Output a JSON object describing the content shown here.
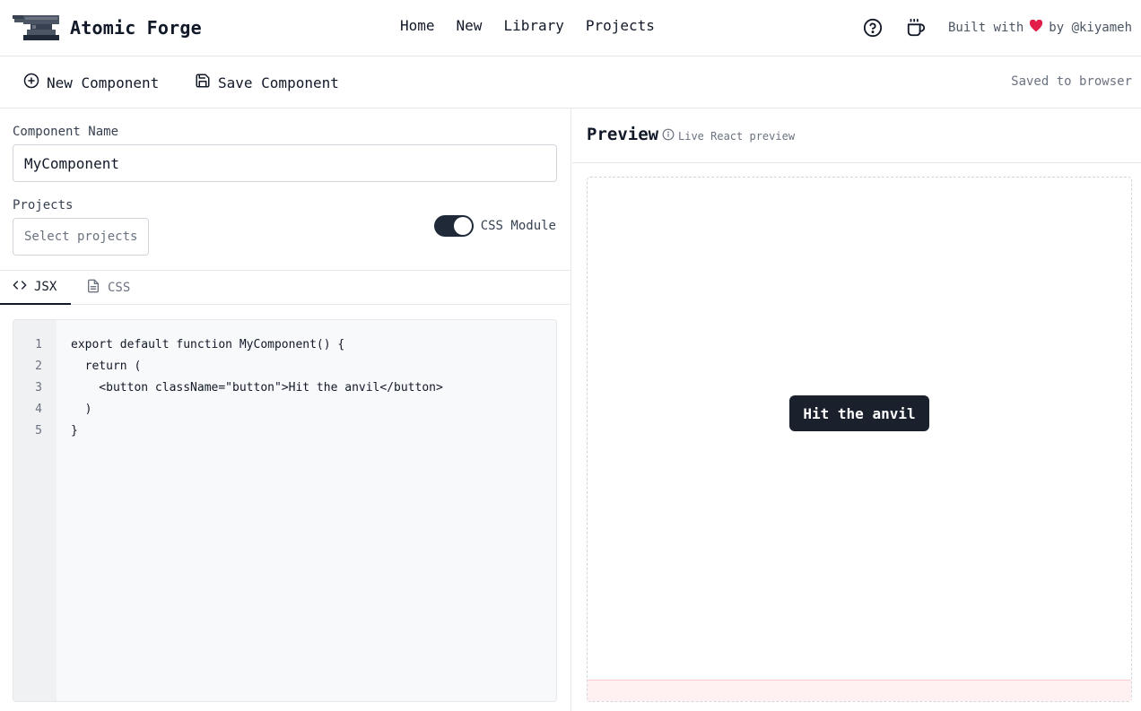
{
  "header": {
    "brand_title": "Atomic Forge",
    "nav": [
      "Home",
      "New",
      "Library",
      "Projects"
    ],
    "built_with": "Built with",
    "by_author": "by @kiyameh",
    "heart_color": "#e11d48"
  },
  "toolbar": {
    "new_component": "New Component",
    "save_component": "Save Component",
    "saved_status": "Saved to browser"
  },
  "form": {
    "component_name_label": "Component Name",
    "component_name_value": "MyComponent",
    "projects_label": "Projects",
    "projects_placeholder": "Select projects",
    "css_module_label": "CSS Module",
    "css_module_enabled": true
  },
  "tabs": {
    "jsx": "JSX",
    "css": "CSS",
    "active": "JSX"
  },
  "editor": {
    "line_numbers": [
      "1",
      "2",
      "3",
      "4",
      "5"
    ],
    "lines": [
      "export default function MyComponent() {",
      "  return (",
      "    <button className=\"button\">Hit the anvil</button>",
      "  )",
      "}"
    ]
  },
  "preview": {
    "title": "Preview",
    "subtitle": "Live React preview",
    "button_label": "Hit the anvil"
  },
  "icons": {
    "logo": "anvil-icon",
    "help": "help-circle-icon",
    "coffee": "coffee-icon",
    "new": "plus-circle-icon",
    "save": "save-icon",
    "info": "info-icon",
    "jsx_tab": "code-icon",
    "css_tab": "file-text-icon"
  }
}
